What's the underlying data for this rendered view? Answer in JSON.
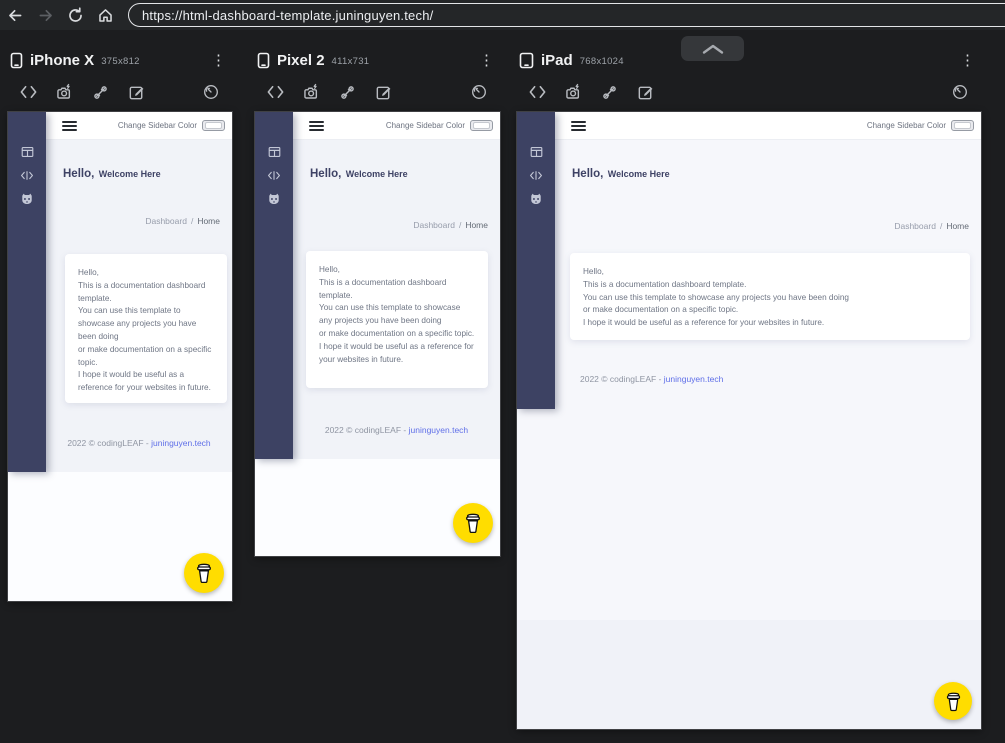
{
  "browser": {
    "url": "https://html-dashboard-template.juninguyen.tech/"
  },
  "header_tools": {
    "kebab_glyph": "⋮"
  },
  "devices": [
    {
      "name": "iPhone X",
      "dims": "375x812"
    },
    {
      "name": "Pixel 2",
      "dims": "411x731"
    },
    {
      "name": "iPad",
      "dims": "768x1024"
    }
  ],
  "site": {
    "change_sidebar_label": "Change Sidebar Color",
    "greeting_bold": "Hello,",
    "greeting_small": "Welcome Here",
    "breadcrumb": [
      "Dashboard",
      "Home"
    ],
    "breadcrumb_sep": "/",
    "card_lines": [
      "Hello,",
      "This is a documentation dashboard template.",
      "You can use this template to showcase any projects you have been doing",
      "or make documentation on a specific topic.",
      "I hope it would be useful as a reference for your websites in future."
    ],
    "footer_text": "2022 © codingLEAF - ",
    "footer_link": "juninguyen.tech",
    "colors": {
      "sidebar": "#3d4263",
      "accent_link": "#5f6fe8",
      "fab_yellow": "#ffdd00"
    }
  }
}
